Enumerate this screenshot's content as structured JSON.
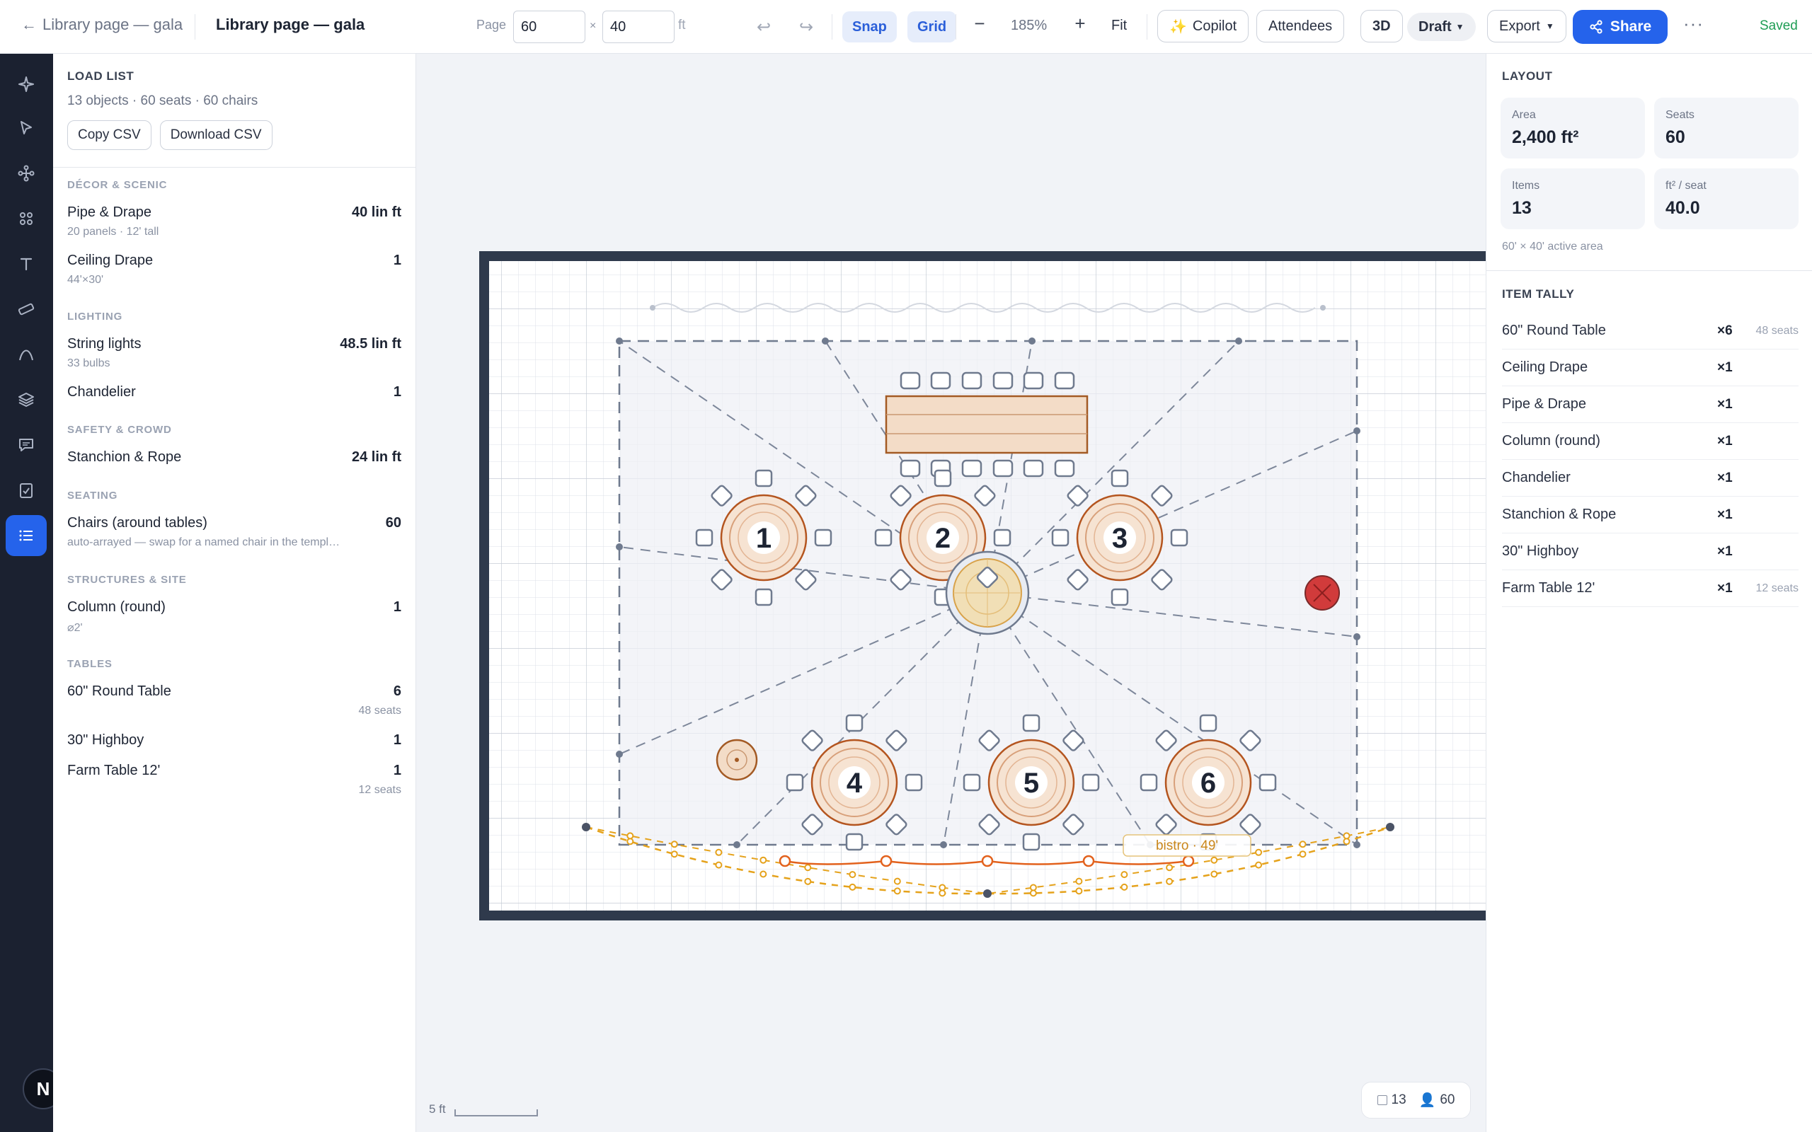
{
  "toolbar": {
    "back_label": "Library page — gala",
    "title": "Library page — gala",
    "page_label": "Page",
    "width_value": "60",
    "height_value": "40",
    "times": "×",
    "unit": "ft",
    "snap": "Snap",
    "grid": "Grid",
    "zoom_out": "−",
    "zoom": "185%",
    "zoom_in": "+",
    "fit": "Fit",
    "copilot": "Copilot",
    "attendees": "Attendees",
    "three_d": "3D",
    "draft": "Draft",
    "export": "Export",
    "share": "Share",
    "saved": "Saved"
  },
  "rail": {
    "items": [
      "sparkle",
      "select",
      "connect",
      "objects",
      "text",
      "measure",
      "curve",
      "layers",
      "comments",
      "checklist",
      "load-list"
    ],
    "logo": "N"
  },
  "load_list": {
    "title": "LOAD LIST",
    "summary": "13 objects · 60 seats · 60 chairs",
    "copy_csv": "Copy CSV",
    "download_csv": "Download CSV",
    "sections": [
      {
        "label": "DÉCOR & SCENIC",
        "items": [
          {
            "name": "Pipe & Drape",
            "detail": "20 panels · 12' tall",
            "value": "40 lin ft"
          },
          {
            "name": "Ceiling Drape",
            "detail": "44'×30'",
            "value": "1"
          }
        ]
      },
      {
        "label": "LIGHTING",
        "items": [
          {
            "name": "String lights",
            "detail": "33 bulbs",
            "value": "48.5 lin ft"
          },
          {
            "name": "Chandelier",
            "value": "1"
          }
        ]
      },
      {
        "label": "SAFETY & CROWD",
        "items": [
          {
            "name": "Stanchion & Rope",
            "value": "24 lin ft"
          }
        ]
      },
      {
        "label": "SEATING",
        "items": [
          {
            "name": "Chairs (around tables)",
            "detail": "auto-arrayed — swap for a named chair in the templ…",
            "value": "60"
          }
        ]
      },
      {
        "label": "STRUCTURES & SITE",
        "items": [
          {
            "name": "Column (round)",
            "detail": "⌀2'",
            "value": "1"
          }
        ]
      },
      {
        "label": "TABLES",
        "items": [
          {
            "name": "60\" Round Table",
            "value": "6",
            "subvalue": "48 seats"
          },
          {
            "name": "30\" Highboy",
            "value": "1"
          },
          {
            "name": "Farm Table 12'",
            "value": "1",
            "subvalue": "12 seats"
          }
        ]
      }
    ]
  },
  "canvas": {
    "table_numbers": [
      "1",
      "2",
      "3",
      "4",
      "5",
      "6"
    ],
    "bistro_label": "bistro · 49'",
    "scale_label": "5 ft",
    "object_count": "13",
    "attendee_count": "60",
    "colors": {
      "room_wall": "#2f3a4c",
      "table_stroke": "#b4551f",
      "table_fill": "#f3d9c3",
      "string_lights": "#e5a21b",
      "stanchion": "#e2611c",
      "red_marker": "#d13b3b"
    }
  },
  "layout": {
    "title": "LAYOUT",
    "stats": [
      {
        "label": "Area",
        "value": "2,400 ft²"
      },
      {
        "label": "Seats",
        "value": "60"
      },
      {
        "label": "Items",
        "value": "13"
      },
      {
        "label": "ft² / seat",
        "value": "40.0"
      }
    ],
    "note": "60' × 40' active area",
    "tally_title": "ITEM TALLY",
    "tally": [
      {
        "name": "60\" Round Table",
        "count": "×6",
        "seats": "48 seats"
      },
      {
        "name": "Ceiling Drape",
        "count": "×1",
        "seats": ""
      },
      {
        "name": "Pipe & Drape",
        "count": "×1",
        "seats": ""
      },
      {
        "name": "Column (round)",
        "count": "×1",
        "seats": ""
      },
      {
        "name": "Chandelier",
        "count": "×1",
        "seats": ""
      },
      {
        "name": "Stanchion & Rope",
        "count": "×1",
        "seats": ""
      },
      {
        "name": "30\" Highboy",
        "count": "×1",
        "seats": ""
      },
      {
        "name": "Farm Table 12'",
        "count": "×1",
        "seats": "12 seats"
      }
    ]
  }
}
